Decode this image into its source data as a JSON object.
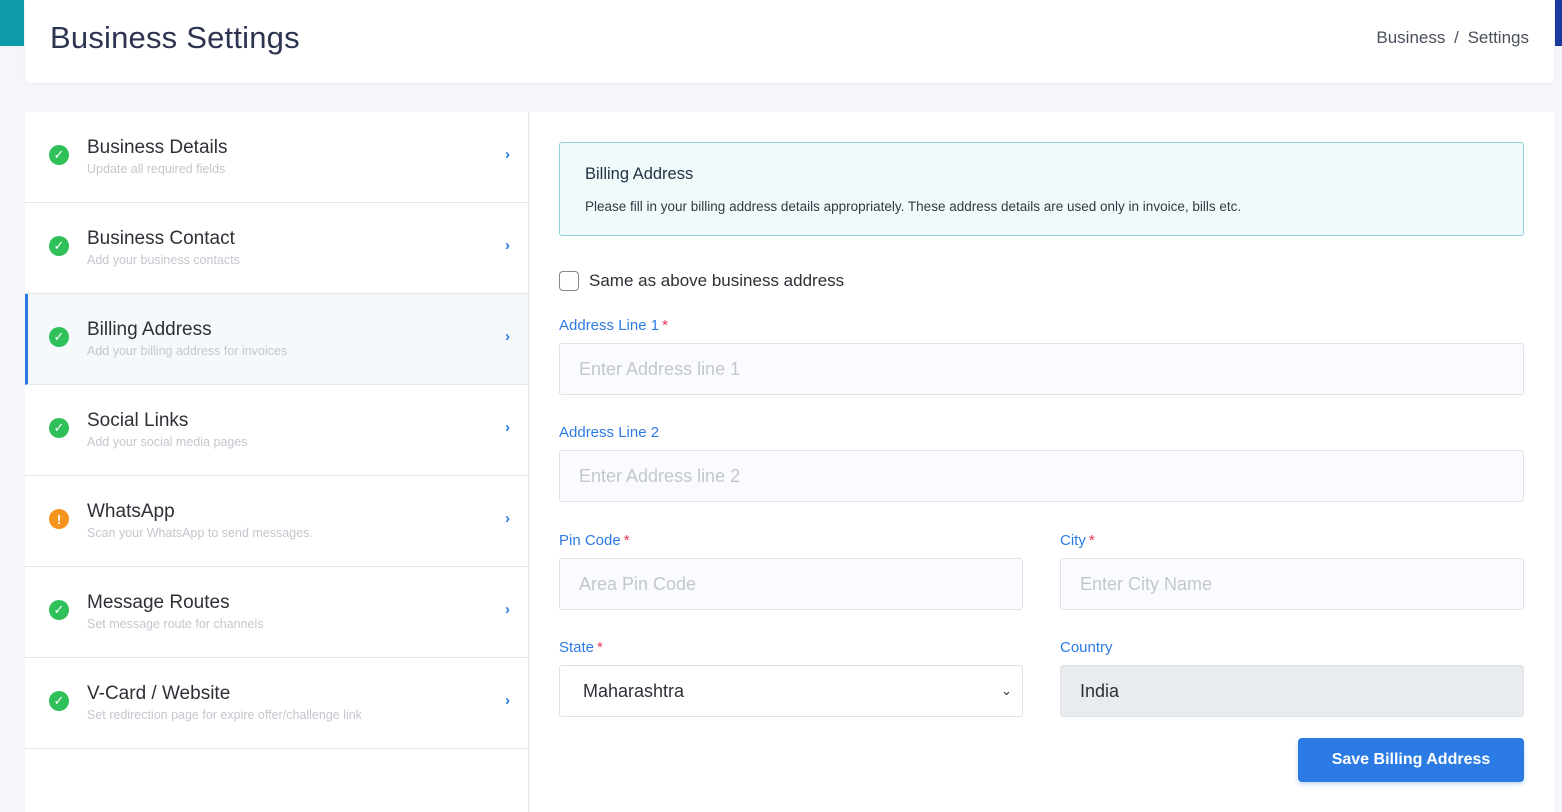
{
  "header": {
    "title": "Business Settings",
    "breadcrumb": [
      "Business",
      "Settings"
    ],
    "breadcrumb_sep": "/"
  },
  "sidebar": {
    "items": [
      {
        "title": "Business Details",
        "subtitle": "Update all required fields",
        "status": "complete",
        "status_icon": "check-circle-icon"
      },
      {
        "title": "Business Contact",
        "subtitle": "Add your business contacts",
        "status": "complete",
        "status_icon": "check-circle-icon"
      },
      {
        "title": "Billing Address",
        "subtitle": "Add your billing address for invoices",
        "status": "complete",
        "status_icon": "check-circle-icon",
        "active": true
      },
      {
        "title": "Social Links",
        "subtitle": "Add your social media pages",
        "status": "complete",
        "status_icon": "check-circle-icon"
      },
      {
        "title": "WhatsApp",
        "subtitle": "Scan your WhatsApp to send messages.",
        "status": "warning",
        "status_icon": "exclamation-circle-icon"
      },
      {
        "title": "Message Routes",
        "subtitle": "Set message route for channels",
        "status": "complete",
        "status_icon": "check-circle-icon"
      },
      {
        "title": "V-Card / Website",
        "subtitle": "Set redirection page for expire offer/challenge link",
        "status": "complete",
        "status_icon": "check-circle-icon"
      }
    ]
  },
  "info": {
    "title": "Billing Address",
    "text": "Please fill in your billing address details appropriately. These address details are used only in invoice, bills etc."
  },
  "form": {
    "same_as_above_label": "Same as above business address",
    "same_as_above_checked": false,
    "address1": {
      "label": "Address Line 1",
      "required": "*",
      "placeholder": "Enter Address line 1",
      "value": ""
    },
    "address2": {
      "label": "Address Line 2",
      "placeholder": "Enter Address line 2",
      "value": ""
    },
    "pincode": {
      "label": "Pin Code",
      "required": "*",
      "placeholder": "Area Pin Code",
      "value": ""
    },
    "city": {
      "label": "City",
      "required": "*",
      "placeholder": "Enter City Name",
      "value": ""
    },
    "state": {
      "label": "State",
      "required": "*",
      "value": "Maharashtra"
    },
    "country": {
      "label": "Country",
      "value": "India"
    },
    "save_label": "Save Billing Address"
  },
  "colors": {
    "accent": "#2c7be5",
    "success": "#2fc05a",
    "warning": "#f7941d",
    "required": "#e63757"
  }
}
